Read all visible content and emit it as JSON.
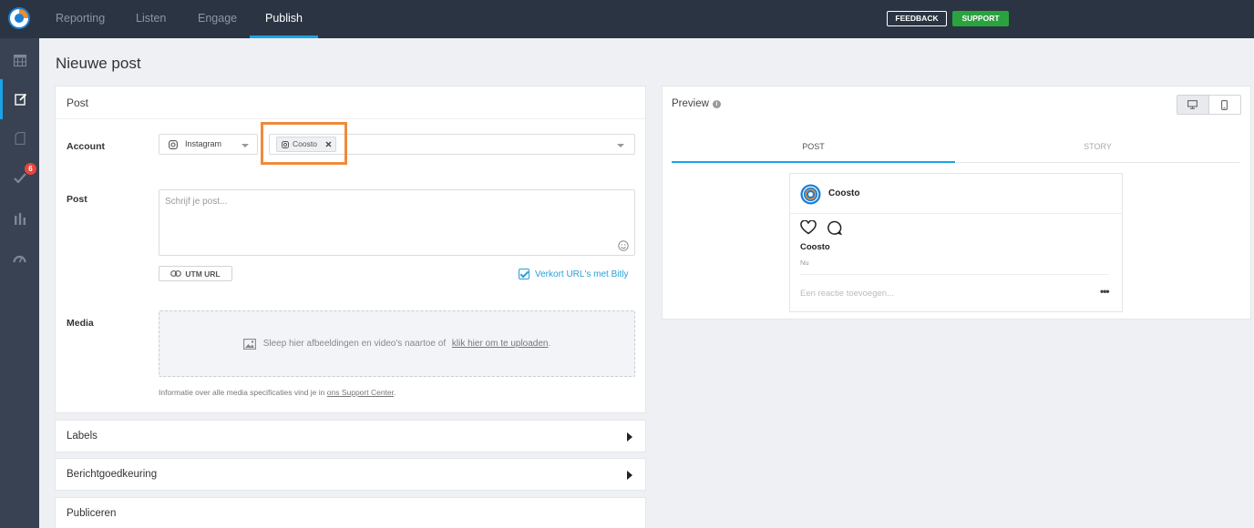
{
  "nav": {
    "tabs": [
      "Reporting",
      "Listen",
      "Engage",
      "Publish"
    ],
    "active_tab": "Publish",
    "feedback_label": "FEEDBACK",
    "support_label": "SUPPORT"
  },
  "sidebar": {
    "items": [
      {
        "icon": "calendar-icon"
      },
      {
        "icon": "compose-icon",
        "active": true
      },
      {
        "icon": "document-icon"
      },
      {
        "icon": "checkmark-icon",
        "badge": "6"
      },
      {
        "icon": "bar-chart-icon"
      },
      {
        "icon": "gauge-icon"
      }
    ]
  },
  "page_title": "Nieuwe post",
  "post_panel": {
    "title": "Post",
    "account_label": "Account",
    "network_value": "Instagram",
    "selected_account": "Coosto",
    "post_label": "Post",
    "post_placeholder": "Schrijf je post...",
    "utm_label": "UTM URL",
    "bitly_label": "Verkort URL's met Bitly",
    "media_label": "Media",
    "dropzone_text": "Sleep hier afbeeldingen en video's naartoe of",
    "dropzone_link": "klik hier om te uploaden",
    "dropzone_end": ".",
    "info_text": "Informatie over alle media specificaties vind je in",
    "info_link": "ons Support Center",
    "info_end": "."
  },
  "sections": [
    "Labels",
    "Berichtgoedkeuring",
    "Publiceren"
  ],
  "preview": {
    "title": "Preview",
    "tabs": [
      "POST",
      "STORY"
    ],
    "account_name": "Coosto",
    "username": "Coosto",
    "time": "Nu",
    "comment_placeholder": "Een reactie toevoegen...",
    "more": "•••"
  },
  "colors": {
    "accent": "#1aa3e8",
    "topbar": "#2b3442",
    "sidebar": "#384252",
    "support": "#2aa33f",
    "highlight": "#f08a3a",
    "badge": "#e8463c"
  }
}
